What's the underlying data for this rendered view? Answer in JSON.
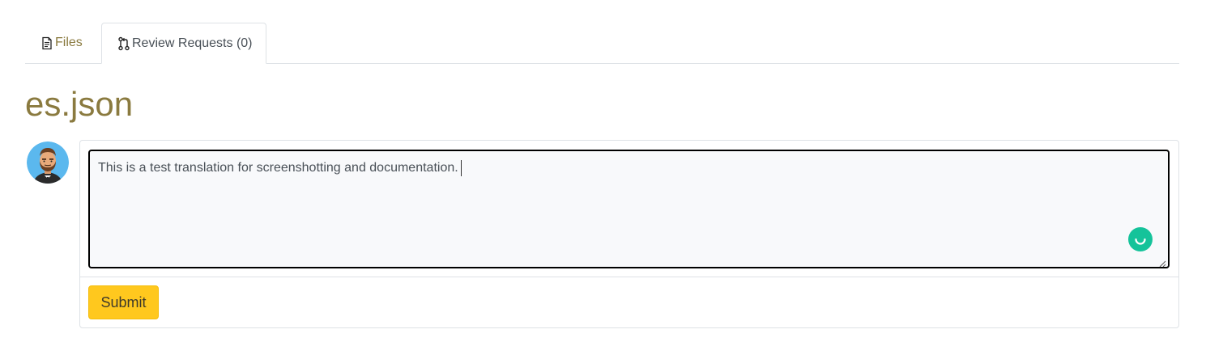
{
  "tabs": [
    {
      "label": "Files",
      "icon": "file-text-icon",
      "active": false
    },
    {
      "label": "Review Requests (0)",
      "icon": "git-pull-request-icon",
      "active": true
    }
  ],
  "page_title": "es.json",
  "comment": {
    "text": "This is a test translation for screenshotting and documentation.",
    "submit_label": "Submit"
  },
  "colors": {
    "accent": "#8a7a3f",
    "submit": "#ffc81e",
    "grammarly": "#15c39a",
    "border": "#dee2e6"
  }
}
